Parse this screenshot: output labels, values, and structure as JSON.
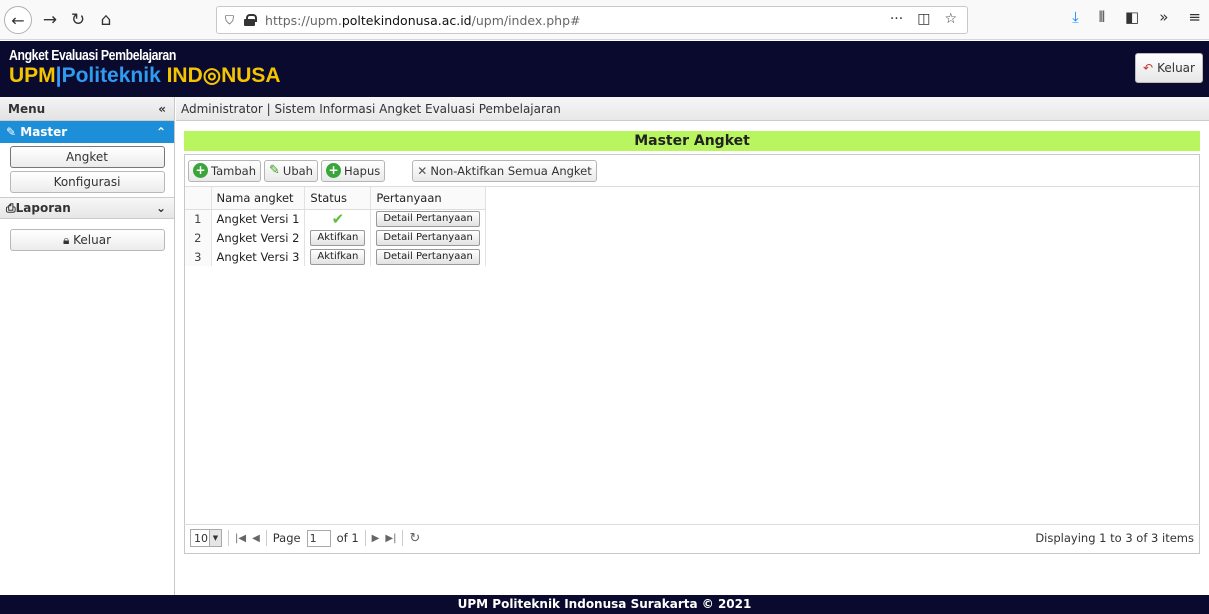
{
  "browser": {
    "url_prefix": "https://upm.",
    "url_domain": "poltekindonusa.ac.id",
    "url_path": "/upm/index.php#",
    "page_actions_glyph": "···"
  },
  "header": {
    "subtitle": "Angket Evaluasi Pembelajaran",
    "title_upm": "UPM",
    "title_bar": "|",
    "title_politeknik": "Politeknik ",
    "title_indonusa": "IND◎NUSA",
    "logout_label": "Keluar"
  },
  "sidebar": {
    "menu_label": "Menu",
    "master_label": "Master",
    "items": [
      {
        "label": "Angket"
      },
      {
        "label": "Konfigurasi"
      }
    ],
    "laporan_label": "Laporan",
    "logout_label": "Keluar"
  },
  "breadcrumb": "Administrator | Sistem Informasi Angket Evaluasi Pembelajaran",
  "main": {
    "title": "Master Angket",
    "toolbar": {
      "add_label": "Tambah",
      "edit_label": "Ubah",
      "delete_label": "Hapus",
      "deactivate_all_label": "Non-Aktifkan Semua Angket"
    },
    "columns": [
      "Nama angket",
      "Status",
      "Pertanyaan"
    ],
    "rows": [
      {
        "num": "1",
        "name": "Angket Versi 1",
        "active": true,
        "status_btn": "",
        "detail_btn": "Detail Pertanyaan"
      },
      {
        "num": "2",
        "name": "Angket Versi 2",
        "active": false,
        "status_btn": "Aktifkan",
        "detail_btn": "Detail Pertanyaan"
      },
      {
        "num": "3",
        "name": "Angket Versi 3",
        "active": false,
        "status_btn": "Aktifkan",
        "detail_btn": "Detail Pertanyaan"
      }
    ]
  },
  "pager": {
    "page_size": "10",
    "page_label": "Page",
    "page_value": "1",
    "of_label": "of 1",
    "display_text": "Displaying 1 to 3 of 3 items"
  },
  "footer": "UPM Politeknik Indonusa Surakarta © 2021",
  "colors": {
    "header_bg": "#0a0a2e",
    "title_bar_bg": "#b8f55f",
    "sidebar_active_bg": "#1d8fd8",
    "brand_yellow": "#f5c400",
    "brand_blue": "#2f9bf0"
  }
}
